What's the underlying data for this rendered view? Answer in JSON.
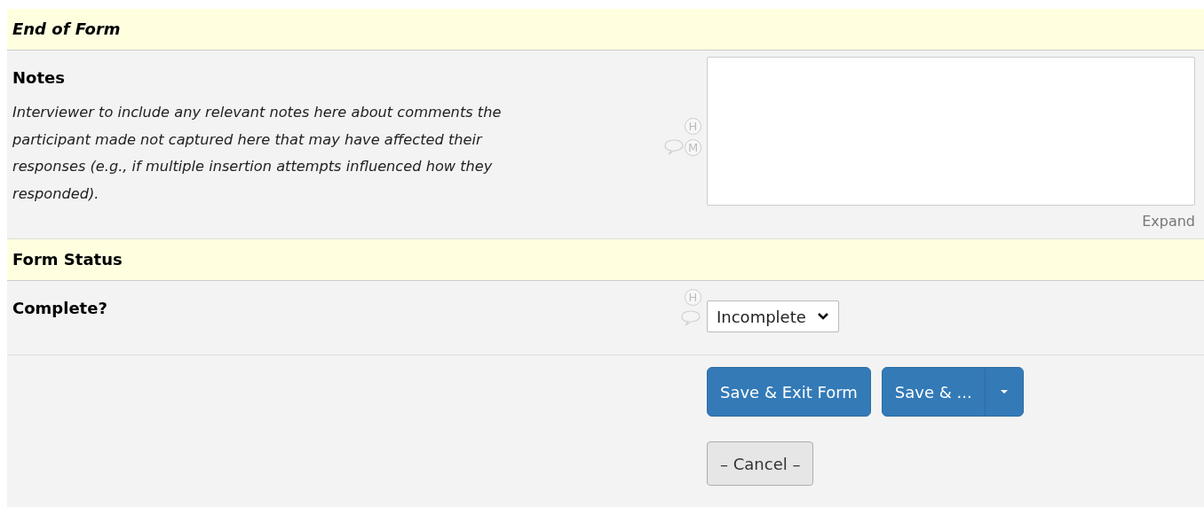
{
  "sections": [
    {
      "kind": "header",
      "title": "End of Form",
      "italic": true
    },
    {
      "kind": "notes",
      "label": "Notes",
      "note": "Interviewer to include any relevant notes here about comments the participant made not captured here that may have affected their responses (e.g., if multiple insertion attempts influenced how they responded).",
      "badges": [
        "H",
        "M"
      ],
      "comment_icon": true,
      "expand": "Expand"
    },
    {
      "kind": "header",
      "title": "Form Status",
      "italic": false
    },
    {
      "kind": "select",
      "label": "Complete?",
      "badges": [
        "H"
      ],
      "comment_icon": true,
      "value": "Incomplete"
    }
  ],
  "actions": {
    "primary": "Save & Exit Form",
    "split": "Save & ...",
    "cancel": "– Cancel –"
  }
}
